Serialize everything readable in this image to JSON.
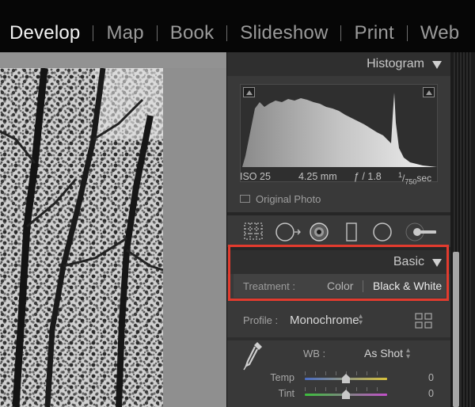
{
  "modules": {
    "items": [
      {
        "label": "Develop",
        "active": true
      },
      {
        "label": "Map",
        "active": false
      },
      {
        "label": "Book",
        "active": false
      },
      {
        "label": "Slideshow",
        "active": false
      },
      {
        "label": "Print",
        "active": false
      },
      {
        "label": "Web",
        "active": false
      }
    ]
  },
  "histogram": {
    "title": "Histogram",
    "iso": "ISO 25",
    "focal_length": "4.25 mm",
    "aperture": "ƒ / 1.8",
    "shutter_numerator": "1",
    "shutter_denominator": "750",
    "shutter_unit": "sec",
    "original_photo_label": "Original Photo"
  },
  "toolstrip": {
    "icons": [
      "crop-overlay-icon",
      "spot-removal-icon",
      "red-eye-icon",
      "graduated-filter-icon",
      "radial-filter-icon",
      "adjustment-brush-icon"
    ]
  },
  "basic": {
    "title": "Basic",
    "treatment_label": "Treatment :",
    "treatment_color": "Color",
    "treatment_bw": "Black & White",
    "treatment_selected": "Black & White",
    "profile_label": "Profile :",
    "profile_value": "Monochrome",
    "wb_label": "WB :",
    "wb_value": "As Shot",
    "sliders": [
      {
        "label": "Temp",
        "value": "0"
      },
      {
        "label": "Tint",
        "value": "0"
      }
    ]
  },
  "colors": {
    "highlight": "#e23b2e",
    "panel_bg": "#393939",
    "active_module": "#f2f2f2",
    "temp_track": [
      "#4a6cc4",
      "#d8c23c"
    ],
    "tint_track": [
      "#3cbf3c",
      "#c24fc9"
    ]
  }
}
